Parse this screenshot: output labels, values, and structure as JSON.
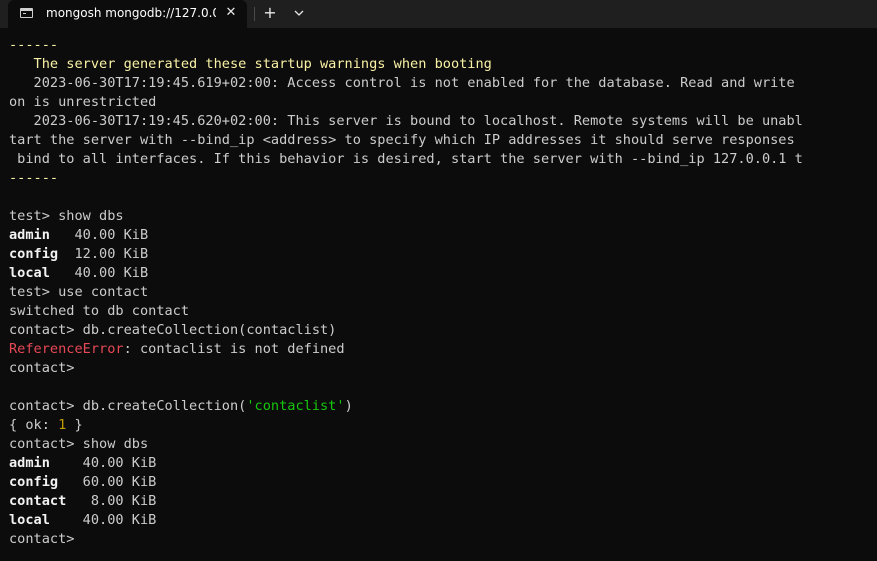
{
  "tab": {
    "title": "mongosh mongodb://127.0.0.",
    "close_glyph": "✕",
    "new_tab_glyph": "+",
    "icon": "terminal-icon"
  },
  "terminal": {
    "separator_top": "------",
    "warning_header": "   The server generated these startup warnings when booting",
    "warning1_line1": "   2023-06-30T17:19:45.619+02:00: Access control is not enabled for the database. Read and write",
    "warning1_line2": "on is unrestricted",
    "warning2_line1": "   2023-06-30T17:19:45.620+02:00: This server is bound to localhost. Remote systems will be unabl",
    "warning2_line2": "tart the server with --bind_ip <address> to specify which IP addresses it should serve responses",
    "warning2_line3": " bind to all interfaces. If this behavior is desired, start the server with --bind_ip 127.0.0.1 t",
    "separator_bottom": "------",
    "cmd1": "test> show dbs",
    "dbs1": [
      {
        "name": "admin",
        "size": "   40.00 KiB"
      },
      {
        "name": "config",
        "size": "  12.00 KiB"
      },
      {
        "name": "local",
        "size": "   40.00 KiB"
      }
    ],
    "cmd2": "test> use contact",
    "out2": "switched to db contact",
    "cmd3": "contact> db.createCollection(contaclist)",
    "err3_name": "ReferenceError",
    "err3_msg": ": contaclist is not defined",
    "prompt4": "contact>",
    "cmd5_prefix": "contact> db.createCollection(",
    "cmd5_arg": "'contaclist'",
    "cmd5_suffix": ")",
    "out5_prefix": "{ ok: ",
    "out5_value": "1",
    "out5_suffix": " }",
    "cmd6": "contact> show dbs",
    "dbs2": [
      {
        "name": "admin",
        "size": "    40.00 KiB"
      },
      {
        "name": "config",
        "size": "   60.00 KiB"
      },
      {
        "name": "contact",
        "size": "   8.00 KiB"
      },
      {
        "name": "local",
        "size": "    40.00 KiB"
      }
    ],
    "prompt_final": "contact>"
  },
  "colors": {
    "background": "#0c0c0c",
    "tabbar": "#1f1f1f",
    "text": "#cccccc",
    "warning": "#f9f1a5",
    "error": "#e74856",
    "string": "#16c60c",
    "number": "#c19c00"
  }
}
